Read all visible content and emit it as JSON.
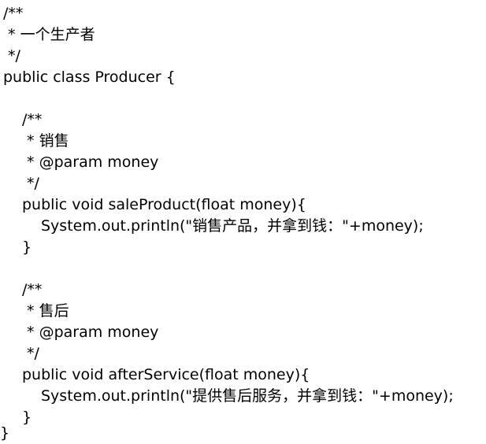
{
  "code": {
    "lines": [
      "/**",
      " * 一个生产者",
      " */",
      "public class Producer {",
      "",
      "/**",
      " * 销售",
      " * @param money",
      " */",
      "public void saleProduct(float money){",
      "System.out.println(\"销售产品，并拿到钱：\"+money);",
      "}",
      "",
      "/**",
      " * 售后",
      " * @param money",
      " */",
      "public void afterService(float money){",
      "System.out.println(\"提供售后服务，并拿到钱：\"+money);",
      "}",
      "}"
    ]
  }
}
